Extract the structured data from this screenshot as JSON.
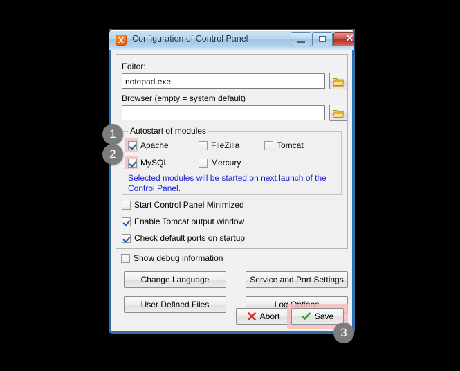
{
  "window": {
    "title": "Configuration of Control Panel",
    "icon": "xampp-icon",
    "controls": {
      "minimize": "minimize-icon",
      "maximize": "maximize-icon",
      "close": "✕"
    }
  },
  "editor": {
    "label": "Editor:",
    "value": "notepad.exe",
    "placeholder": "",
    "browse_icon": "folder-icon"
  },
  "browser": {
    "label": "Browser (empty = system default)",
    "value": "",
    "placeholder": "",
    "browse_icon": "folder-icon"
  },
  "autostart": {
    "title": "Autostart of modules",
    "modules": [
      {
        "label": "Apache",
        "checked": true,
        "highlighted": true
      },
      {
        "label": "FileZilla",
        "checked": false,
        "highlighted": false
      },
      {
        "label": "Tomcat",
        "checked": false,
        "highlighted": false
      },
      {
        "label": "MySQL",
        "checked": true,
        "highlighted": true
      },
      {
        "label": "Mercury",
        "checked": false,
        "highlighted": false
      }
    ],
    "note": "Selected modules will be started on next launch of the Control Panel.",
    "note_color": "#1919d6"
  },
  "options": [
    {
      "label": "Start Control Panel Minimized",
      "checked": false
    },
    {
      "label": "Enable Tomcat output window",
      "checked": true
    },
    {
      "label": "Check default ports on startup",
      "checked": true
    },
    {
      "label": "Show debug information",
      "checked": false
    }
  ],
  "buttons": {
    "change_language": "Change Language",
    "service_and_port_settings": "Service and Port Settings",
    "user_defined_files": "User Defined Files",
    "log_options": "Log Options",
    "abort": "Abort",
    "save": "Save",
    "abort_icon": "red-x-icon",
    "save_icon": "green-check-icon"
  },
  "annotations": {
    "badges": [
      {
        "number": "1",
        "target": "apache-checkbox"
      },
      {
        "number": "2",
        "target": "mysql-checkbox"
      },
      {
        "number": "3",
        "target": "save-button"
      }
    ],
    "highlight_color": "#f4c0c0",
    "badge_color": "#7c7c7c"
  }
}
